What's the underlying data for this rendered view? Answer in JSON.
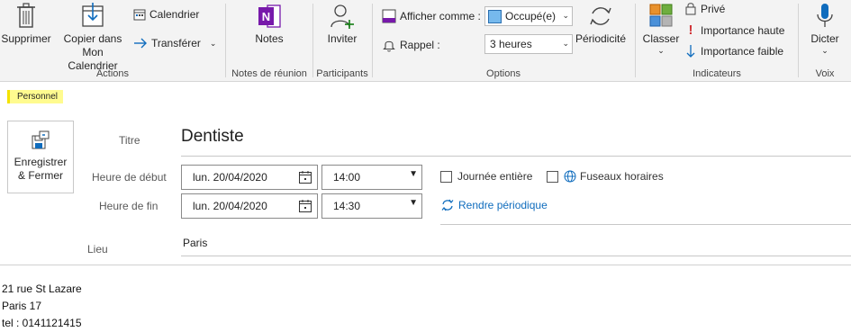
{
  "ribbon": {
    "actions": {
      "group_label": "Actions",
      "delete": "Supprimer",
      "copy_line1": "Copier dans",
      "copy_line2": "Mon Calendrier",
      "calendar": "Calendrier",
      "forward": "Transférer"
    },
    "meeting_notes": {
      "group_label": "Notes de réunion",
      "notes": "Notes"
    },
    "participants": {
      "group_label": "Participants",
      "invite": "Inviter"
    },
    "options": {
      "group_label": "Options",
      "show_as_label": "Afficher comme :",
      "show_as_value": "Occupé(e)",
      "reminder_label": "Rappel :",
      "reminder_value": "3 heures",
      "recurrence": "Périodicité"
    },
    "tags": {
      "group_label": "Indicateurs",
      "categorize": "Classer",
      "private": "Privé",
      "high_importance": "Importance haute",
      "low_importance": "Importance faible"
    },
    "voice": {
      "group_label": "Voix",
      "dictate": "Dicter"
    }
  },
  "category_tag": "Personnel",
  "save_close": {
    "line1": "Enregistrer",
    "line2": "& Fermer"
  },
  "form": {
    "title_label": "Titre",
    "title_value": "Dentiste",
    "start_label": "Heure de début",
    "start_date": "lun. 20/04/2020",
    "start_time": "14:00",
    "end_label": "Heure de fin",
    "end_date": "lun. 20/04/2020",
    "end_time": "14:30",
    "all_day": "Journée entière",
    "time_zones": "Fuseaux horaires",
    "make_recurring": "Rendre périodique",
    "location_label": "Lieu",
    "location_value": "Paris"
  },
  "body_lines": [
    "21 rue St Lazare",
    "Paris 17",
    "tel : 0141121415"
  ],
  "colors": {
    "accent": "#0f6cbd",
    "category": "#fffb8f",
    "onenote": "#7719aa",
    "high_importance": "#d13438"
  }
}
